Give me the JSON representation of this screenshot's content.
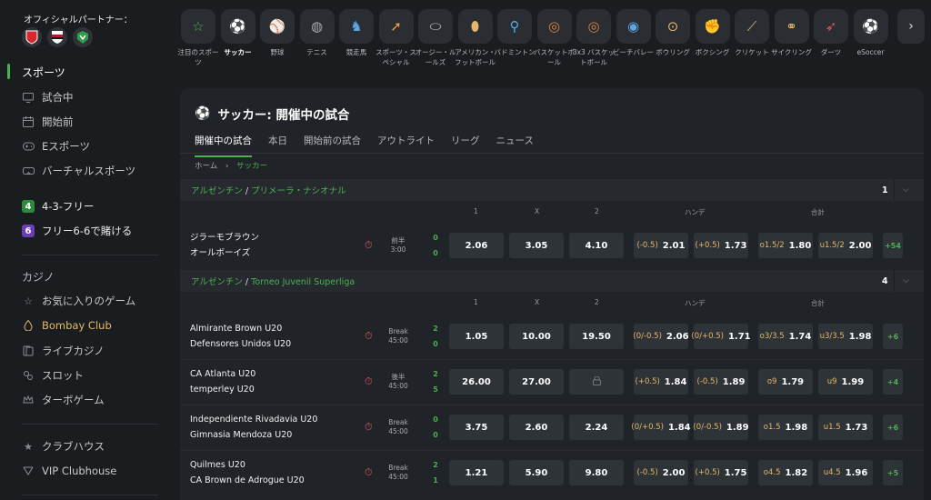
{
  "sidebar": {
    "partner_title": "オフィシャルパートナー：",
    "sports_label": "スポーツ",
    "items": [
      {
        "label": "試合中",
        "icon": "monitor-icon"
      },
      {
        "label": "開始前",
        "icon": "calendar-icon"
      },
      {
        "label": "Eスポーツ",
        "icon": "gamepad-icon"
      },
      {
        "label": "バーチャルスポーツ",
        "icon": "vr-icon"
      }
    ],
    "promos": [
      {
        "badge": "4",
        "label": "4-3-フリー"
      },
      {
        "badge": "6",
        "label": "フリー6-6で賭ける"
      }
    ],
    "casino_label": "カジノ",
    "casino_items": [
      {
        "label": "お気に入りのゲーム",
        "icon": "star-icon"
      },
      {
        "label": "Bombay Club",
        "icon": "bombay-icon"
      },
      {
        "label": "ライブカジノ",
        "icon": "live-casino-icon"
      },
      {
        "label": "スロット",
        "icon": "slot-icon"
      },
      {
        "label": "ターボゲーム",
        "icon": "crown-icon"
      }
    ],
    "club_items": [
      {
        "label": "クラブハウス",
        "icon": "star-icon"
      },
      {
        "label": "VIP Clubhouse",
        "icon": "vip-icon"
      }
    ]
  },
  "sports": [
    {
      "label": "注目のスポーツ",
      "icon": "star-icon",
      "glyph": "☆"
    },
    {
      "label": "サッカー",
      "icon": "soccer-icon",
      "glyph": "⚽"
    },
    {
      "label": "野球",
      "icon": "baseball-icon",
      "glyph": "⚾"
    },
    {
      "label": "テニス",
      "icon": "tennis-icon",
      "glyph": "◍"
    },
    {
      "label": "競走馬",
      "icon": "horse-racing-icon",
      "glyph": "♞"
    },
    {
      "label": "スポーツ・スペシャル",
      "icon": "rocket-icon",
      "glyph": "➚"
    },
    {
      "label": "オージー・ルールズ",
      "icon": "aussie-rules-icon",
      "glyph": "⬭"
    },
    {
      "label": "アメリカン・フットボール",
      "icon": "american-football-icon",
      "glyph": "⬮"
    },
    {
      "label": "バドミントン",
      "icon": "badminton-icon",
      "glyph": "⚲"
    },
    {
      "label": "バスケットボール",
      "icon": "basketball-icon",
      "glyph": "◎"
    },
    {
      "label": "3x3 バスケットボール",
      "icon": "basketball-3x3-icon",
      "glyph": "◎"
    },
    {
      "label": "ビーチバレー",
      "icon": "volleyball-icon",
      "glyph": "◉"
    },
    {
      "label": "ボウリング",
      "icon": "bowling-icon",
      "glyph": "⊙"
    },
    {
      "label": "ボクシング",
      "icon": "boxing-icon",
      "glyph": "✊"
    },
    {
      "label": "クリケット",
      "icon": "cricket-icon",
      "glyph": "⟋"
    },
    {
      "label": "サイクリング",
      "icon": "cycling-icon",
      "glyph": "⚭"
    },
    {
      "label": "ダーツ",
      "icon": "darts-icon",
      "glyph": "➶"
    },
    {
      "label": "eSoccer",
      "icon": "esoccer-icon",
      "glyph": "⚽"
    }
  ],
  "main": {
    "title": "サッカー: 開催中の試合",
    "tabs": [
      "開催中の試合",
      "本日",
      "開始前の試合",
      "アウトライト",
      "リーグ",
      "ニュース"
    ],
    "breadcrumb": {
      "home": "ホーム",
      "sep": "›",
      "current": "サッカー"
    },
    "col_headers": {
      "one": "1",
      "x": "X",
      "two": "2",
      "handicap": "ハンデ",
      "total": "合計"
    },
    "leagues": [
      {
        "country": "アルゼンチン",
        "sep": " / ",
        "name": "プリメーラ・ナシオナル",
        "count": "1",
        "matches": [
          {
            "home": "ジラーモブラウン",
            "away": "オールボーイズ",
            "period": "前半",
            "time": "3:00",
            "score_home": "0",
            "score_away": "0",
            "odds": [
              "2.06",
              "3.05",
              "4.10"
            ],
            "hcp": [
              {
                "line": "(-0.5)",
                "odd": "2.01"
              },
              {
                "line": "(+0.5)",
                "odd": "1.73"
              }
            ],
            "tot": [
              {
                "line": "o1.5/2",
                "odd": "1.80"
              },
              {
                "line": "u1.5/2",
                "odd": "2.00"
              }
            ],
            "more": "+54"
          }
        ]
      },
      {
        "country": "アルゼンチン",
        "sep": " / ",
        "name": "Torneo Juvenil Superliga",
        "count": "4",
        "matches": [
          {
            "home": "Almirante Brown U20",
            "away": "Defensores Unidos U20",
            "period": "Break",
            "time": "45:00",
            "score_home": "2",
            "score_away": "0",
            "odds": [
              "1.05",
              "10.00",
              "19.50"
            ],
            "hcp": [
              {
                "line": "(0/-0.5)",
                "odd": "2.06"
              },
              {
                "line": "(0/+0.5)",
                "odd": "1.71"
              }
            ],
            "tot": [
              {
                "line": "o3/3.5",
                "odd": "1.74"
              },
              {
                "line": "u3/3.5",
                "odd": "1.98"
              }
            ],
            "more": "+6"
          },
          {
            "home": "CA Atlanta U20",
            "away": "temperley U20",
            "period": "後半",
            "time": "45:00",
            "score_home": "2",
            "score_away": "5",
            "odds": [
              "26.00",
              "27.00",
              ""
            ],
            "locked": true,
            "hcp": [
              {
                "line": "(+0.5)",
                "odd": "1.84"
              },
              {
                "line": "(-0.5)",
                "odd": "1.89"
              }
            ],
            "tot": [
              {
                "line": "o9",
                "odd": "1.79"
              },
              {
                "line": "u9",
                "odd": "1.99"
              }
            ],
            "more": "+4"
          },
          {
            "home": "Independiente Rivadavia U20",
            "away": "Gimnasia Mendoza U20",
            "period": "Break",
            "time": "45:00",
            "score_home": "0",
            "score_away": "0",
            "odds": [
              "3.75",
              "2.60",
              "2.24"
            ],
            "hcp": [
              {
                "line": "(0/+0.5)",
                "odd": "1.84"
              },
              {
                "line": "(0/-0.5)",
                "odd": "1.89"
              }
            ],
            "tot": [
              {
                "line": "o1.5",
                "odd": "1.98"
              },
              {
                "line": "u1.5",
                "odd": "1.73"
              }
            ],
            "more": "+6"
          },
          {
            "home": "Quilmes U20",
            "away": "CA Brown de Adrogue U20",
            "period": "Break",
            "time": "45:00",
            "score_home": "2",
            "score_away": "1",
            "odds": [
              "1.21",
              "5.90",
              "9.80"
            ],
            "hcp": [
              {
                "line": "(-0.5)",
                "odd": "2.00"
              },
              {
                "line": "(+0.5)",
                "odd": "1.75"
              }
            ],
            "tot": [
              {
                "line": "o4.5",
                "odd": "1.82"
              },
              {
                "line": "u4.5",
                "odd": "1.96"
              }
            ],
            "more": "+5"
          }
        ]
      }
    ]
  },
  "colors": {
    "accent": "#4caf50",
    "gold": "#e4b866",
    "timer": "#e05555"
  }
}
